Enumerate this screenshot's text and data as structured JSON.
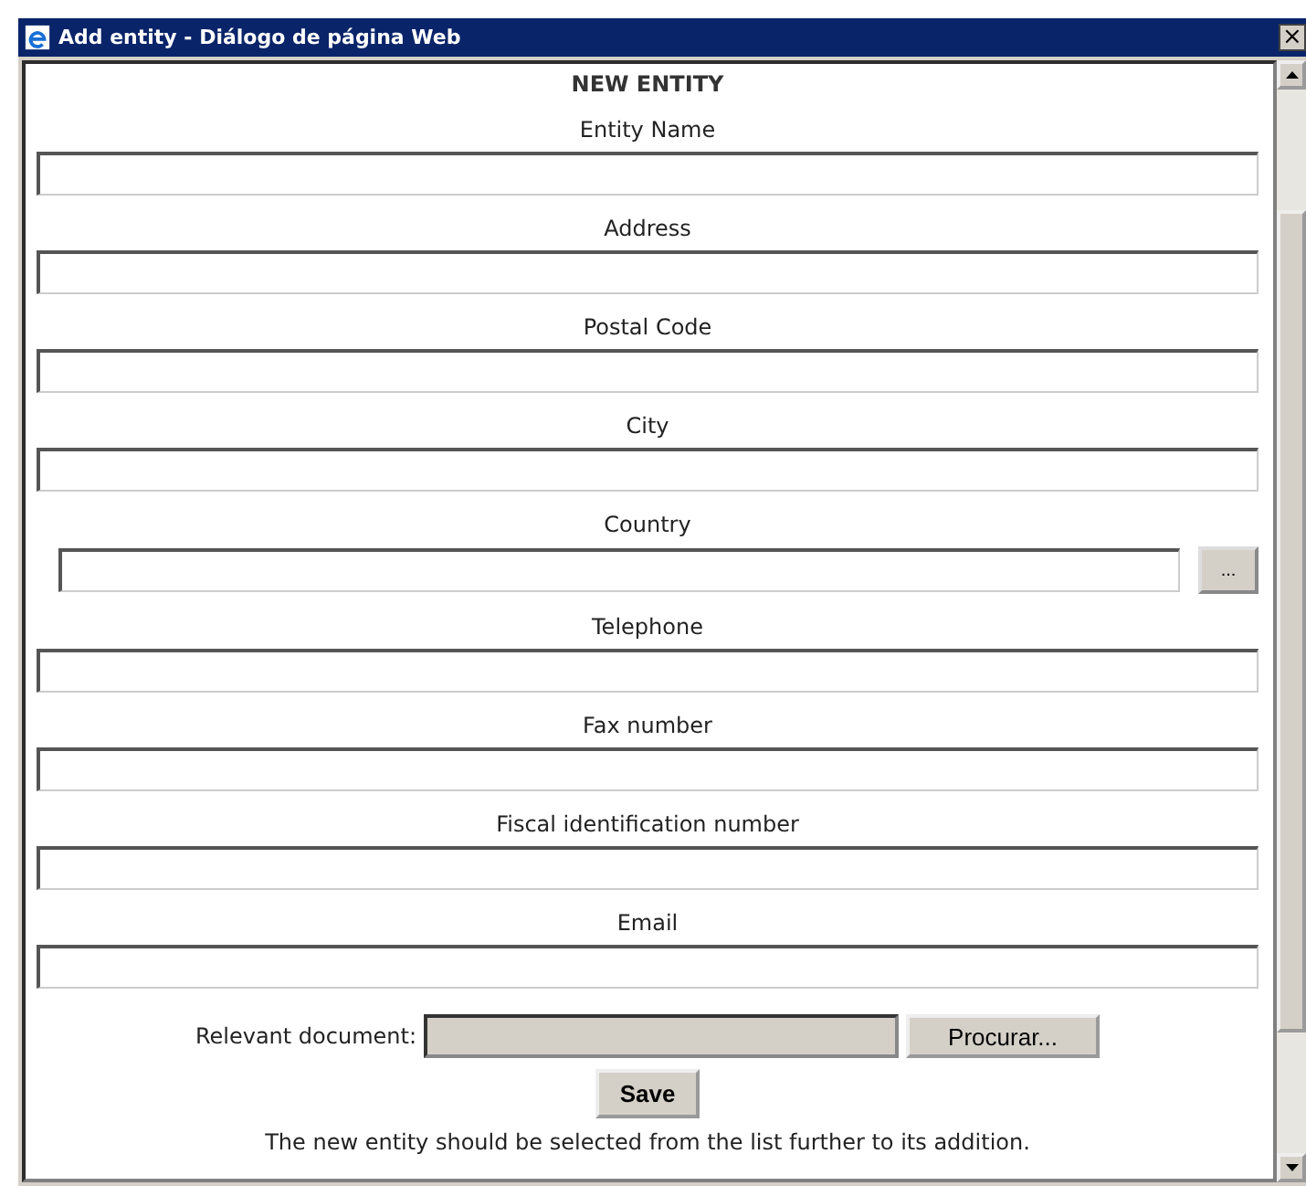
{
  "window": {
    "title": "Add entity - Diálogo de página Web",
    "close": "×"
  },
  "heading": "NEW ENTITY",
  "fields": [
    {
      "kind": "text",
      "label": "Entity Name"
    },
    {
      "kind": "text",
      "label": "Address"
    },
    {
      "kind": "text",
      "label": "Postal Code"
    },
    {
      "kind": "text",
      "label": "City"
    },
    {
      "kind": "lookup",
      "label": "Country",
      "button": "..."
    },
    {
      "kind": "text",
      "label": "Telephone"
    },
    {
      "kind": "text",
      "label": "Fax number"
    },
    {
      "kind": "text",
      "label": "Fiscal identification number"
    },
    {
      "kind": "text",
      "label": "Email"
    }
  ],
  "document": {
    "label": "Relevant document:",
    "button": "Procurar..."
  },
  "save_button": "Save",
  "note": "The new entity should be selected from the list further to its addition."
}
